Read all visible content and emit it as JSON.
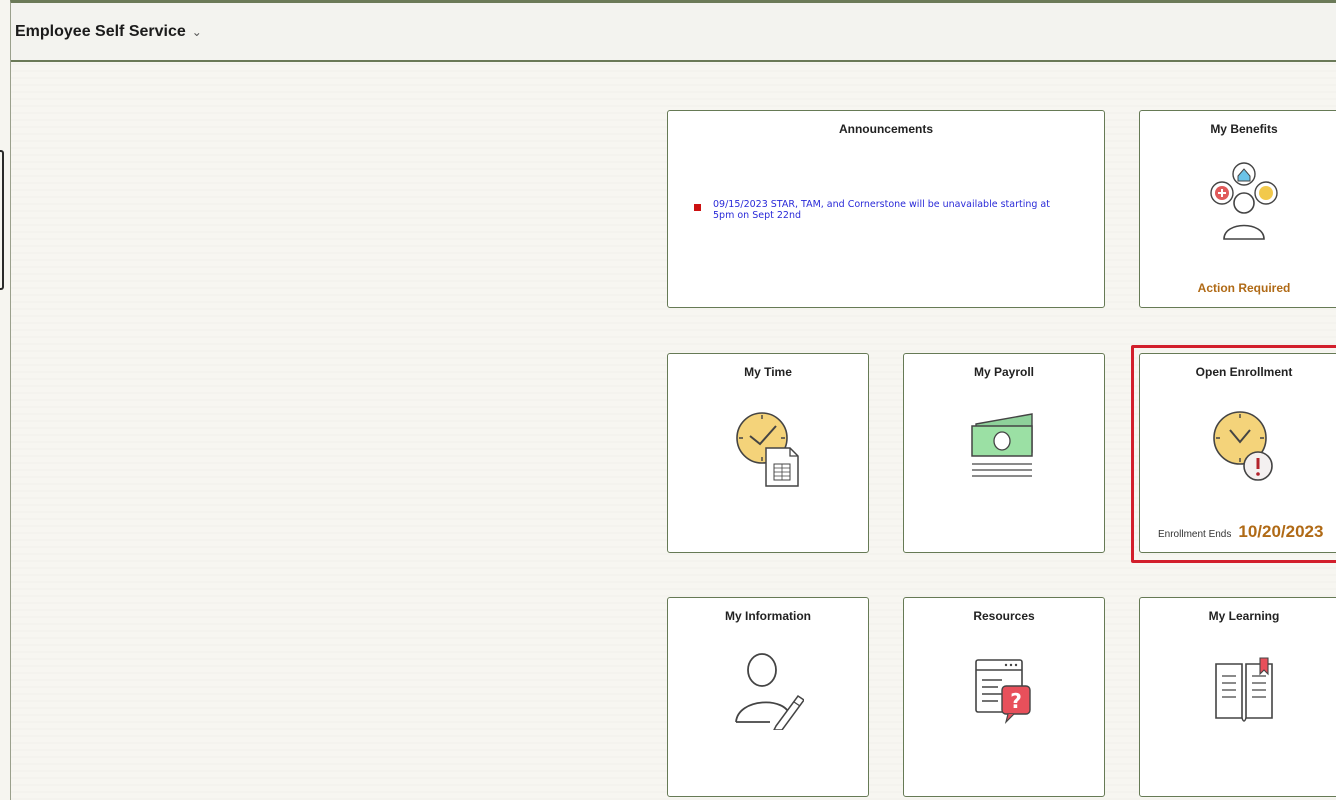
{
  "header": {
    "title": "Employee Self Service",
    "chevron": "⌄"
  },
  "tiles": {
    "announcements": {
      "title": "Announcements",
      "items": [
        "09/15/2023 STAR, TAM, and Cornerstone will be unavailable starting at 5pm on Sept 22nd"
      ]
    },
    "my_benefits": {
      "title": "My Benefits",
      "status": "Action Required",
      "icon": "benefits-icon"
    },
    "my_time": {
      "title": "My Time",
      "icon": "clock-timesheet-icon"
    },
    "my_payroll": {
      "title": "My Payroll",
      "icon": "money-icon"
    },
    "open_enrollment": {
      "title": "Open Enrollment",
      "icon": "clock-alert-icon",
      "footer_label": "Enrollment Ends",
      "footer_date": "10/20/2023"
    },
    "my_information": {
      "title": "My Information",
      "icon": "person-edit-icon"
    },
    "resources": {
      "title": "Resources",
      "icon": "help-document-icon"
    },
    "my_learning": {
      "title": "My Learning",
      "icon": "book-icon"
    }
  },
  "colors": {
    "tile_border": "#667a55",
    "accent_orange": "#b06a16",
    "highlight_red": "#d21f2c",
    "link_blue": "#2a2ad8"
  }
}
